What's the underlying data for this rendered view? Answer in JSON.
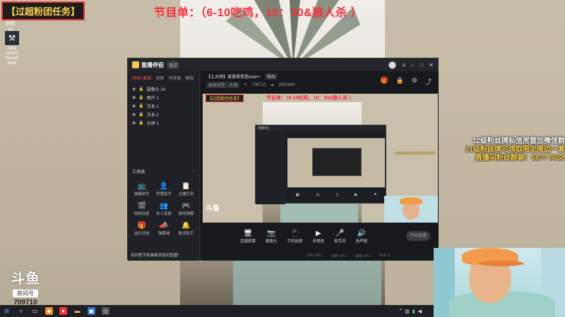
{
  "overlay": {
    "fan_task": "【过超粉团任务】",
    "schedule": "节目单：（6-10吃鸡，10：30&狼人杀 ）",
    "promo_lines": [
      "12级粉丝牌私信房管加微信群",
      "21级粉丝牌可领取限定周边一套",
      "直播间粉丝群聊：0877 8658"
    ]
  },
  "desktop": {
    "recycle_label": "回收站",
    "app_icon_label": "New World Closed Beta"
  },
  "douyu": {
    "logo": "斗鱼",
    "room_label": "房间号",
    "room_number": "709710"
  },
  "app": {
    "name": "直播伴侣",
    "tag": "测试",
    "sidebar_tabs": [
      "场景1画面",
      "竖屏",
      "场景版",
      "模板"
    ],
    "layers": [
      "摄像头 24",
      "图片 1",
      "文本 1",
      "文本 2",
      "全屏 1"
    ],
    "tools_title": "工具箱",
    "tools": [
      {
        "icon": "📺",
        "label": "弹幕助手"
      },
      {
        "icon": "👤",
        "label": "房管助手"
      },
      {
        "icon": "📋",
        "label": "主播任务"
      },
      {
        "icon": "🎬",
        "label": "视频连麦"
      },
      {
        "icon": "👥",
        "label": "多人连麦"
      },
      {
        "icon": "🎮",
        "label": "游戏弹幕"
      },
      {
        "icon": "🎁",
        "label": "送礼特效"
      },
      {
        "icon": "📣",
        "label": "弹幕墙"
      },
      {
        "icon": "🔔",
        "label": "歌词助手"
      }
    ],
    "sidebar_footer": "如何把手机画面添加到直播？",
    "stream_title": "【上大师】双排单带逆cool～",
    "edit_label": "修改",
    "category": "绝地求生 · 大地",
    "room_id": "709710",
    "followers": "2950840",
    "controls": [
      {
        "icon": "🖥",
        "label": "直播屏幕"
      },
      {
        "icon": "📷",
        "label": "摄像头"
      },
      {
        "icon": "📱",
        "label": "手机投屏"
      },
      {
        "icon": "▶",
        "label": "多媒体"
      },
      {
        "icon": "🎤",
        "label": "麦克风"
      },
      {
        "icon": "🔊",
        "label": "扬声器"
      }
    ],
    "start_live": "开始直播",
    "status": [
      "CPU: 0%",
      "内存: 0%",
      "丢帧: 0%",
      "FPS: 0"
    ]
  },
  "preview": {
    "fan_task": "【过超粉团任务】",
    "schedule": "节目单：（6-10吃鸡，10：30&狼人杀 ）",
    "promo": "12级粉丝牌私信房管加微信群"
  }
}
